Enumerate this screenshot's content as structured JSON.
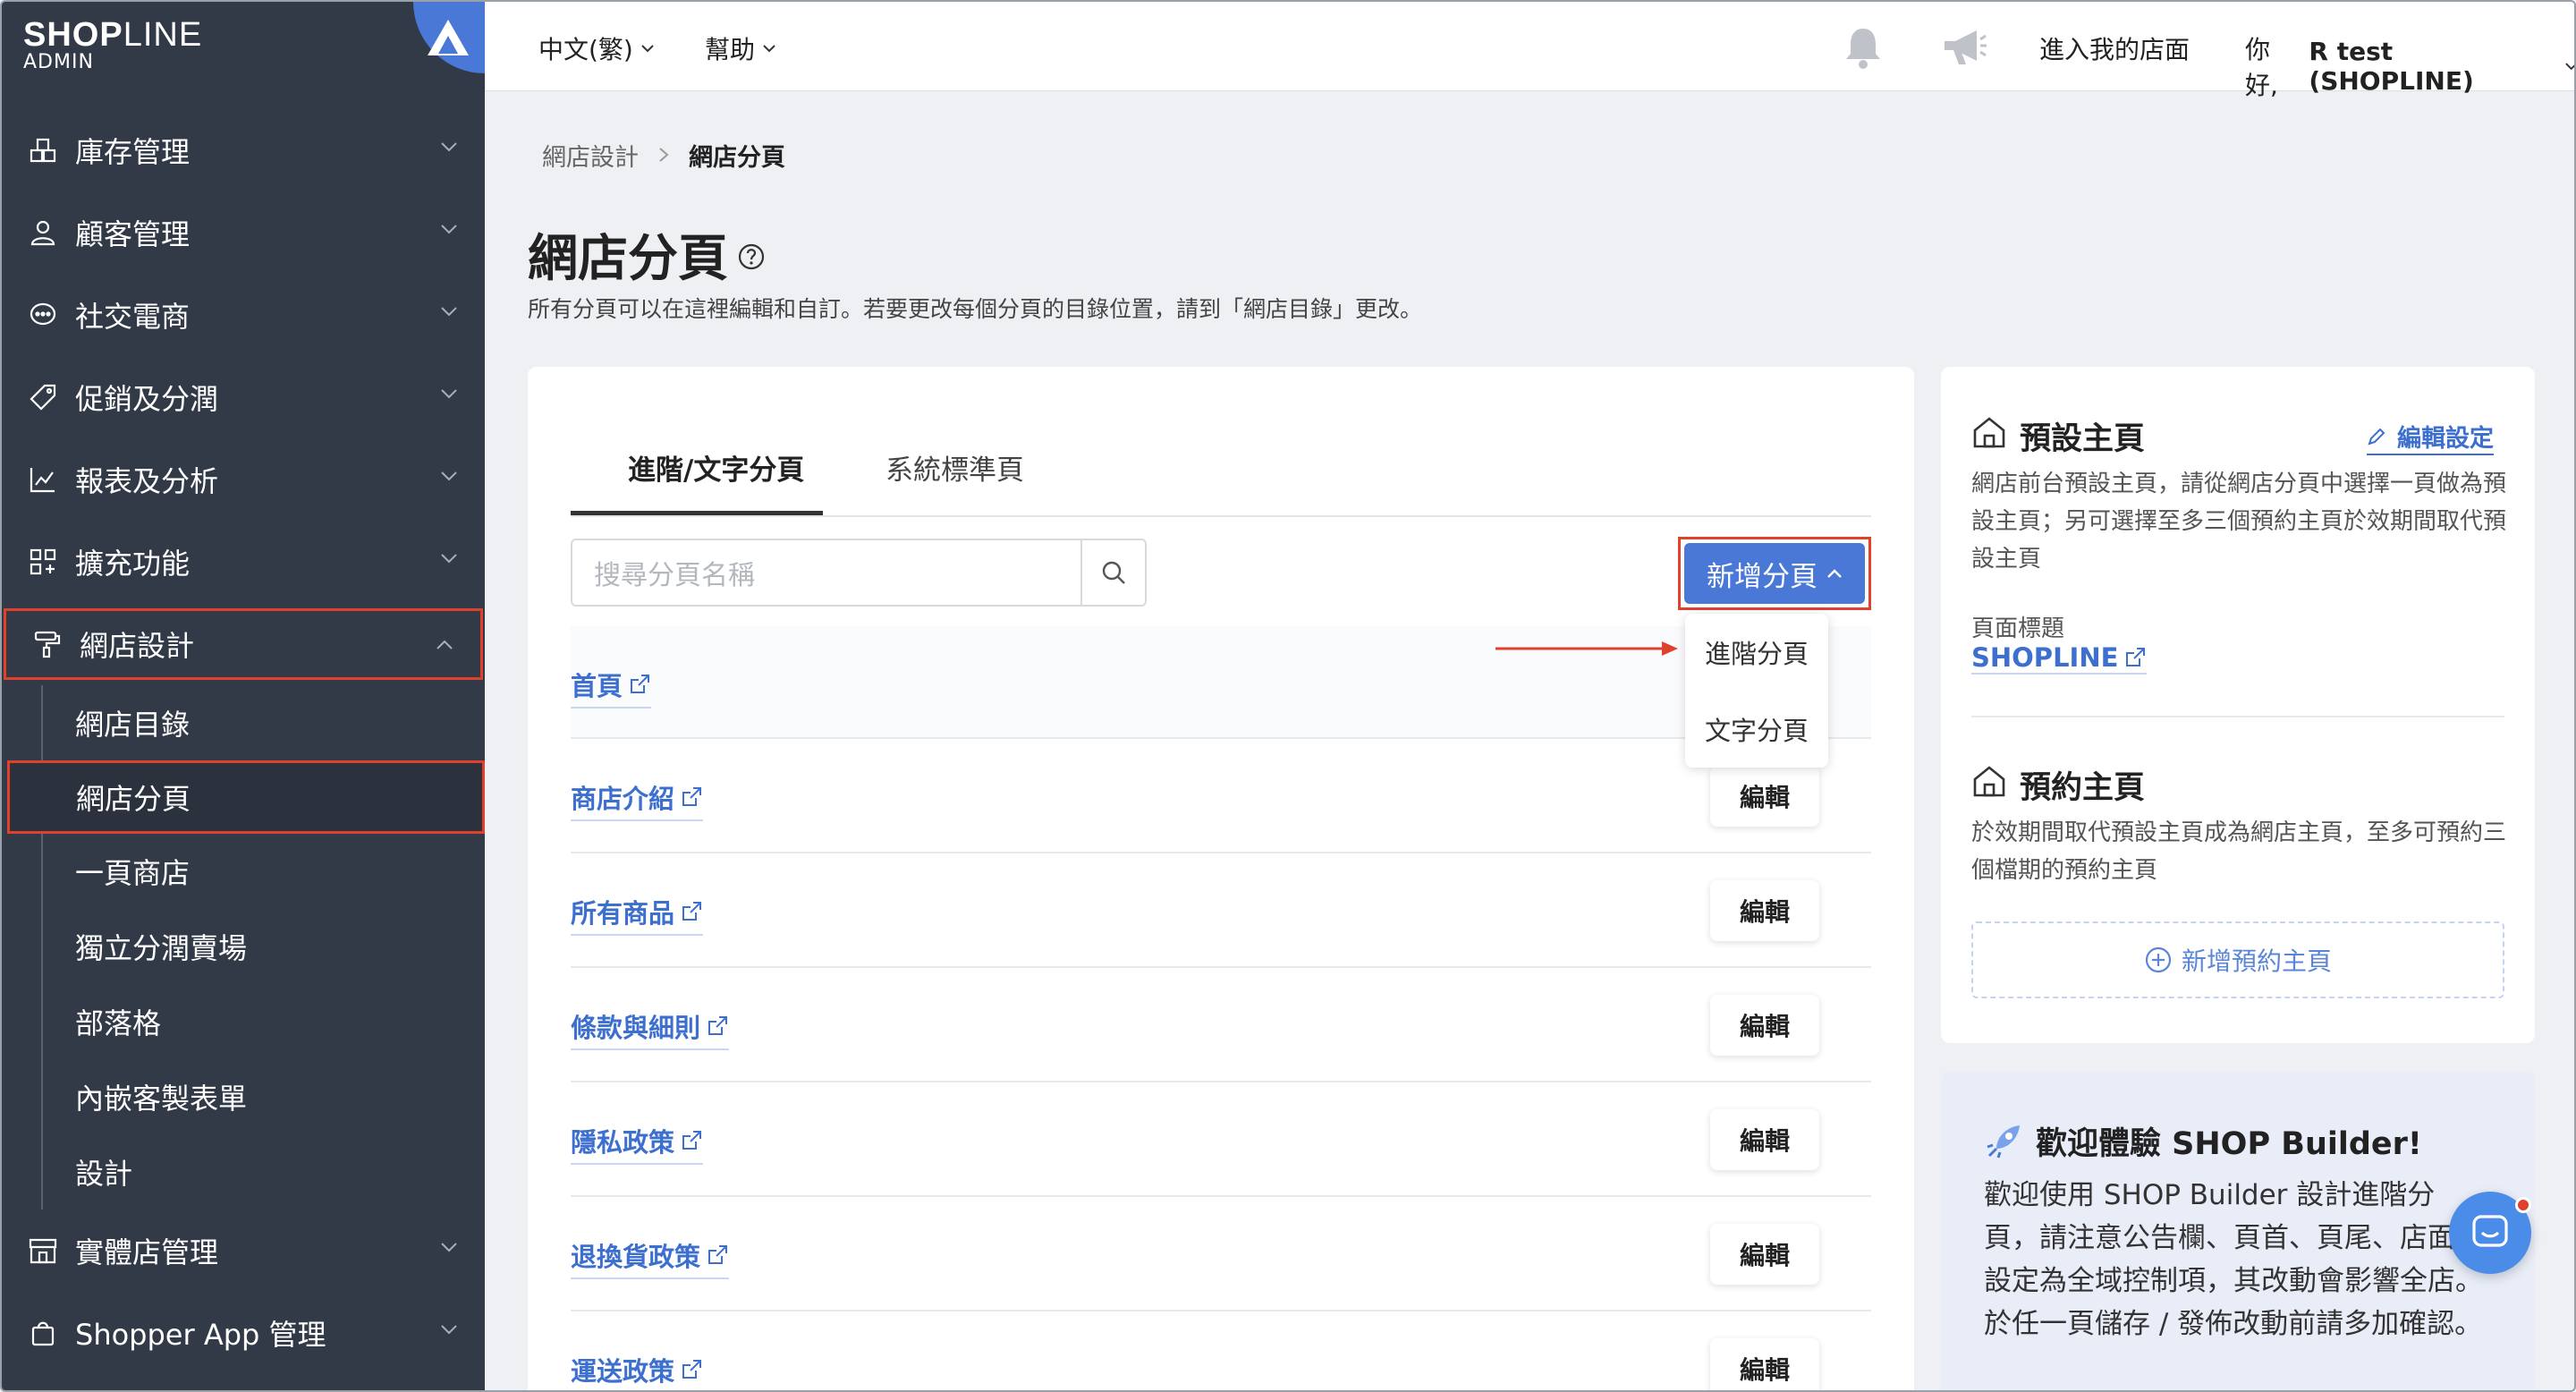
{
  "brand": {
    "logo": "SHOPLINE",
    "logo_bold": "SHOP",
    "logo_light": "LINE",
    "sub": "ADMIN"
  },
  "sidebar": {
    "items": [
      {
        "label": "庫存管理",
        "icon": "inventory-icon"
      },
      {
        "label": "顧客管理",
        "icon": "customer-icon"
      },
      {
        "label": "社交電商",
        "icon": "chat-bubble-icon"
      },
      {
        "label": "促銷及分潤",
        "icon": "tag-icon"
      },
      {
        "label": "報表及分析",
        "icon": "chart-icon"
      },
      {
        "label": "擴充功能",
        "icon": "apps-icon"
      },
      {
        "label": "網店設計",
        "icon": "paint-roller-icon"
      }
    ],
    "subitems": [
      "網店目錄",
      "網店分頁",
      "一頁商店",
      "獨立分潤賣場",
      "部落格",
      "內嵌客製表單",
      "設計"
    ],
    "bottom_items": [
      {
        "label": "實體店管理",
        "icon": "store-icon"
      },
      {
        "label": "Shopper App 管理",
        "icon": "shopping-bag-icon"
      }
    ]
  },
  "topbar": {
    "language": "中文(繁)",
    "help": "幫助",
    "enter_store": "進入我的店面",
    "greeting": "你好,",
    "user": "R test (SHOPLINE)"
  },
  "breadcrumb": {
    "parent": "網店設計",
    "current": "網店分頁"
  },
  "page": {
    "title": "網店分頁",
    "description": "所有分頁可以在這裡編輯和自訂。若要更改每個分頁的目錄位置，請到「網店目錄」更改。"
  },
  "tabs": [
    "進階/文字分頁",
    "系統標準頁"
  ],
  "search": {
    "placeholder": "搜尋分頁名稱"
  },
  "add_button": "新增分頁",
  "dropdown": [
    "進階分頁",
    "文字分頁"
  ],
  "pages": [
    {
      "name": "首頁"
    },
    {
      "name": "商店介紹",
      "action": "編輯"
    },
    {
      "name": "所有商品",
      "action": "編輯"
    },
    {
      "name": "條款與細則",
      "action": "編輯"
    },
    {
      "name": "隱私政策",
      "action": "編輯"
    },
    {
      "name": "退換貨政策",
      "action": "編輯"
    },
    {
      "name": "運送政策",
      "action": "編輯"
    }
  ],
  "default_home": {
    "title": "預設主頁",
    "edit_label": "編輯設定",
    "description": "網店前台預設主頁，請從網店分頁中選擇一頁做為預設主頁；另可選擇至多三個預約主頁於效期間取代預設主頁",
    "page_title_label": "頁面標題",
    "page_title_value": "SHOPLINE"
  },
  "scheduled_home": {
    "title": "預約主頁",
    "description": "於效期間取代預設主頁成為網店主頁，至多可預約三個檔期的預約主頁",
    "add_label": "新增預約主頁"
  },
  "promo": {
    "title": "歡迎體驗 SHOP Builder!",
    "text": "歡迎使用 SHOP Builder 設計進階分頁，請注意公告欄、頁首、頁尾、店面級設定為全域控制項，其改動會影響全店。於任一頁儲存 / 發佈改動前請多加確認。"
  },
  "colors": {
    "sidebar": "#323a47",
    "accent": "#4a78d6",
    "highlight": "#e0412d",
    "link": "#3d6fce"
  }
}
